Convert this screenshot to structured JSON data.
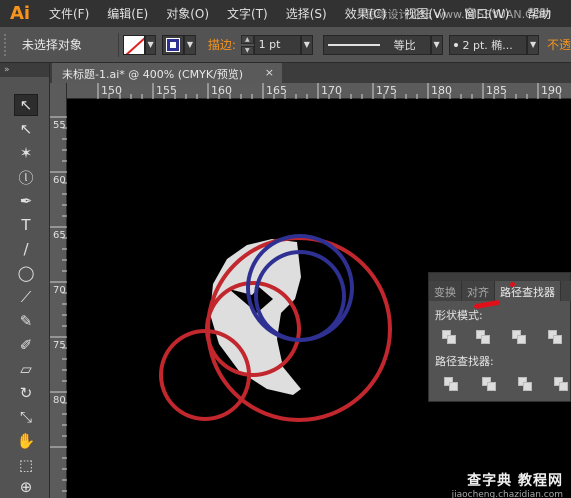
{
  "menubar": {
    "app_logo": "Ai",
    "items": [
      "文件(F)",
      "编辑(E)",
      "对象(O)",
      "文字(T)",
      "选择(S)",
      "效果(C)",
      "视图(V)",
      "窗口(W)",
      "帮助"
    ],
    "watermark": "思缘设计论坛 www.MISSYUAN.COM"
  },
  "controlbar": {
    "selection_status": "未选择对象",
    "stroke_label": "描边:",
    "stroke_weight": "1 pt",
    "profile_label": "等比",
    "brush_label": "2 pt. 椭...",
    "opacity_label": "不透",
    "fill_color": "#ffffff",
    "stroke_color": "#2e3192"
  },
  "toolbox": {
    "collapse": "»",
    "tools": [
      {
        "name": "selection-tool",
        "glyph": "↖",
        "active": true
      },
      {
        "name": "direct-selection-tool",
        "glyph": "↖"
      },
      {
        "name": "magic-wand-tool",
        "glyph": "✶"
      },
      {
        "name": "lasso-tool",
        "glyph": "ⓛ"
      },
      {
        "name": "pen-tool",
        "glyph": "✒"
      },
      {
        "name": "type-tool",
        "glyph": "T"
      },
      {
        "name": "line-tool",
        "glyph": "/"
      },
      {
        "name": "ellipse-tool",
        "glyph": "◯"
      },
      {
        "name": "paintbrush-tool",
        "glyph": "⟋"
      },
      {
        "name": "pencil-tool",
        "glyph": "✎"
      },
      {
        "name": "blob-brush-tool",
        "glyph": "✐"
      },
      {
        "name": "eraser-tool",
        "glyph": "▱"
      },
      {
        "name": "rotate-tool",
        "glyph": "↻"
      },
      {
        "name": "scale-tool",
        "glyph": "⤡"
      },
      {
        "name": "warp-tool",
        "glyph": "✋"
      },
      {
        "name": "free-transform-tool",
        "glyph": "⬚"
      },
      {
        "name": "shape-builder-tool",
        "glyph": "⊕"
      }
    ]
  },
  "document": {
    "tab_title": "未标题-1.ai* @ 400% (CMYK/预览)",
    "close_glyph": "×"
  },
  "rulers": {
    "horizontal": [
      "150",
      "155",
      "160",
      "165",
      "170",
      "175",
      "180",
      "185",
      "190"
    ],
    "vertical": [
      "55",
      "60",
      "65",
      "70",
      "75",
      "80"
    ]
  },
  "colors": {
    "red_circle": "#c1272d",
    "blue_circle": "#2e3192",
    "shape_fill": "#dedede"
  },
  "pathfinder_panel": {
    "tabs": [
      "变换",
      "对齐",
      "路径查找器"
    ],
    "active_tab": 2,
    "shape_modes_label": "形状模式:",
    "pathfinders_label": "路径查找器:"
  },
  "watermark_bottom": {
    "main": "查字典 教程网",
    "url": "jiaocheng.chazidian.com"
  }
}
